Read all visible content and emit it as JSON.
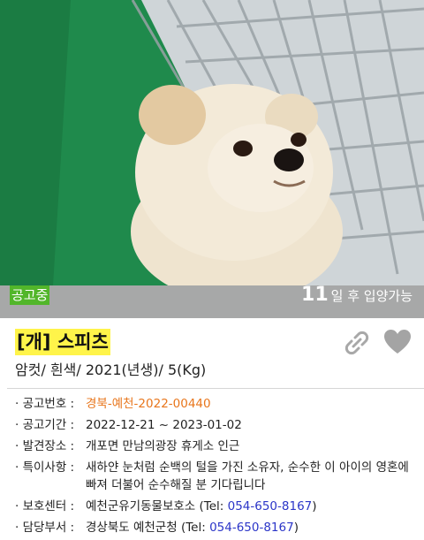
{
  "photo": {
    "subject": "white spitz dog in shelter kennel"
  },
  "status": {
    "badge": "공고중",
    "days": "11",
    "days_suffix": "일 후 입양가능",
    "badge_color": "#52b62a"
  },
  "animal": {
    "title": "[개] 스피츠",
    "summary": "암컷/ 흰색/ 2021(년생)/ 5(Kg)"
  },
  "actions": {
    "link_icon": "link-icon",
    "favorite_icon": "heart-icon"
  },
  "info": {
    "notice_no": {
      "label": "· 공고번호 :",
      "value": "경북-예천-2022-00440"
    },
    "notice_period": {
      "label": "· 공고기간 :",
      "value": "2022-12-21 ~ 2023-01-02"
    },
    "found_place": {
      "label": "· 발견장소 :",
      "value": "개포면 만남의광장 휴게소 인근"
    },
    "features": {
      "label": "· 특이사항 :",
      "value": "새하얀 눈처럼 순백의 털을 가진 소유자, 순수한 이 아이의 영혼에 빠져 더불어 순수해질 분 기다립니다"
    },
    "shelter": {
      "label": "· 보호센터 :",
      "name": "예천군유기동물보호소 (Tel: ",
      "tel": "054-650-8167",
      "close": ")"
    },
    "department": {
      "label": "· 담당부서 :",
      "name": "경상북도 예천군청 (Tel: ",
      "tel": "054-650-8167",
      "close": ")"
    }
  },
  "colors": {
    "accent_orange": "#e8761c",
    "link_blue": "#2b35c8",
    "highlight": "#fff44a"
  }
}
